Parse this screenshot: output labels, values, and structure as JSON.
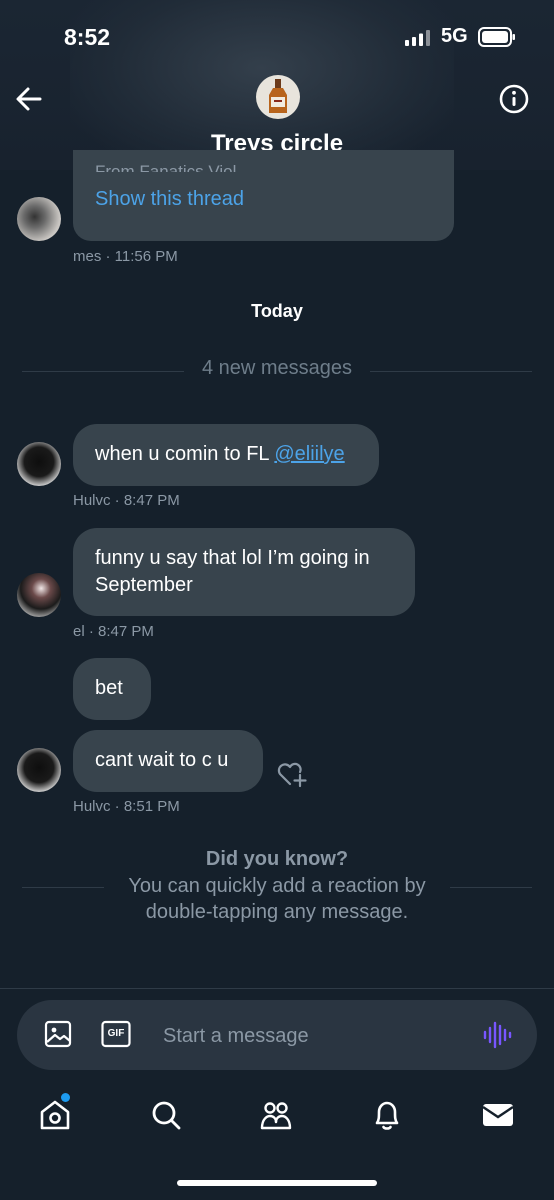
{
  "status_bar": {
    "time": "8:52",
    "network": "5G"
  },
  "header": {
    "title": "Treys circle"
  },
  "thread_preview": {
    "sender_time": "mes · 11:56 PM",
    "cut_text": "From Fanatics Viol.",
    "link_label": "Show this thread"
  },
  "day_separator": "Today",
  "new_messages_divider": "4 new messages",
  "messages": [
    {
      "pre": "when u comin to FL ",
      "mention": "@eliilye",
      "meta": "Hulvc · 8:47 PM"
    },
    {
      "line1": "funny u say that lol I’m going in",
      "line2": "September",
      "meta": "el · 8:47 PM"
    },
    {
      "text": "bet"
    },
    {
      "text": "cant wait to c u",
      "meta": "Hulvc · 8:51 PM"
    }
  ],
  "tip": {
    "title": "Did you know?",
    "line1": "You can quickly add a reaction by",
    "line2": "double-tapping any message."
  },
  "composer": {
    "placeholder": "Start a message",
    "gif_label": "GIF"
  },
  "colors": {
    "background": "#15202b",
    "bubble": "#38444d",
    "link": "#4ca3e8",
    "voice_accent": "#7856ff",
    "notification_dot": "#1d9bf0"
  },
  "icons": [
    "back-arrow-icon",
    "info-icon",
    "image-icon",
    "gif-icon",
    "voice-icon",
    "home-icon",
    "search-icon",
    "communities-icon",
    "bell-icon",
    "mail-icon",
    "add-reaction-icon"
  ]
}
